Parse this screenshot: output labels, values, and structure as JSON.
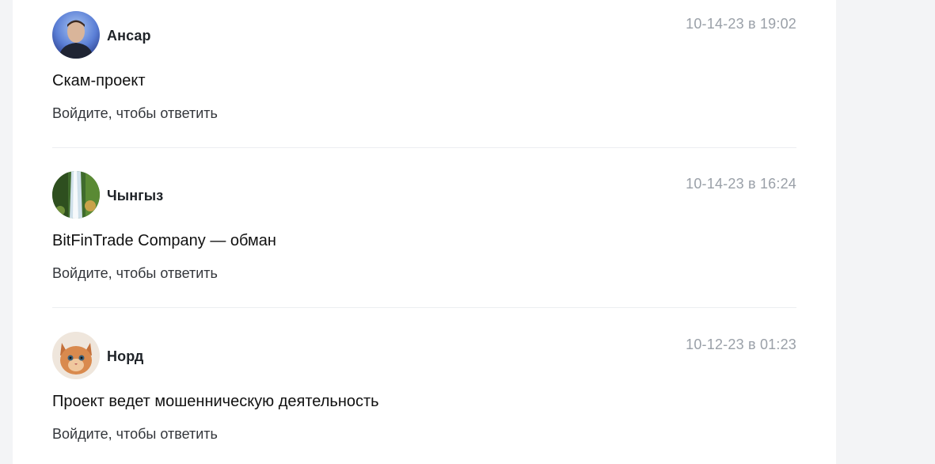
{
  "comments": [
    {
      "author": "Ансар",
      "avatar_icon": "user-photo-icon",
      "timestamp": "10-14-23 в 19:02",
      "text": "Скам-проект",
      "reply_label": "Войдите, чтобы ответить"
    },
    {
      "author": "Чынгыз",
      "avatar_icon": "waterfall-photo-icon",
      "timestamp": "10-14-23 в 16:24",
      "text": "BitFinTrade Company — обман",
      "reply_label": "Войдите, чтобы ответить"
    },
    {
      "author": "Норд",
      "avatar_icon": "kitten-photo-icon",
      "timestamp": "10-12-23 в 01:23",
      "text": "Проект ведет мошенническую деятельность",
      "reply_label": "Войдите, чтобы ответить"
    }
  ],
  "colors": {
    "page_background": "#f3f4f6",
    "card_background": "#ffffff",
    "timestamp": "#9aa0a8",
    "divider": "#eceef1"
  }
}
